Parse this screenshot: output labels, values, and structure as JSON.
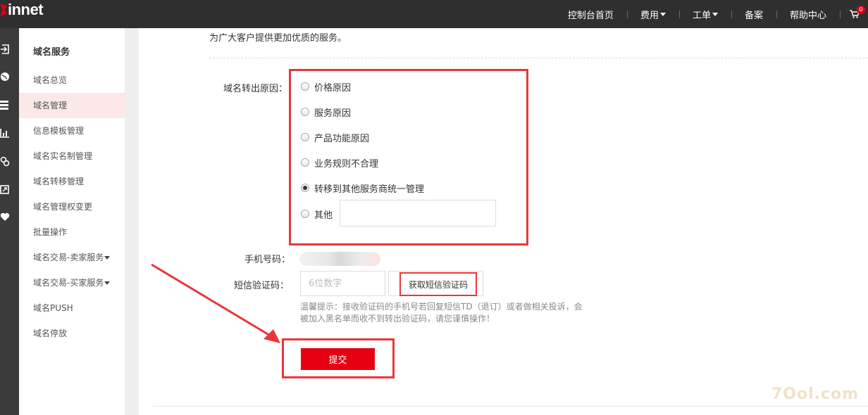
{
  "brand": {
    "logo_text": "innet"
  },
  "topnav": {
    "items": [
      {
        "label": "控制台首页",
        "has_caret": false
      },
      {
        "label": "费用",
        "has_caret": true
      },
      {
        "label": "工单",
        "has_caret": true
      },
      {
        "label": "备案",
        "has_caret": false
      },
      {
        "label": "帮助中心",
        "has_caret": false
      }
    ],
    "cart_count": "0"
  },
  "rail": {
    "icons": [
      "sign-in-icon",
      "globe-icon",
      "server-icon",
      "chart-icon",
      "link-icon",
      "resize-icon",
      "heart-icon"
    ]
  },
  "sidebar": {
    "title": "域名服务",
    "items": [
      {
        "label": "域名总览",
        "active": false
      },
      {
        "label": "域名管理",
        "active": true
      },
      {
        "label": "信息模板管理",
        "active": false
      },
      {
        "label": "域名实名制管理",
        "active": false
      },
      {
        "label": "域名转移管理",
        "active": false
      },
      {
        "label": "域名管理权变更",
        "active": false
      },
      {
        "label": "批量操作",
        "active": false
      },
      {
        "label": "域名交易-卖家服务",
        "active": false,
        "has_caret": true
      },
      {
        "label": "域名交易-买家服务",
        "active": false,
        "has_caret": true
      },
      {
        "label": "域名PUSH",
        "active": false
      },
      {
        "label": "域名停放",
        "active": false
      }
    ]
  },
  "form": {
    "intro_text": "为广大客户提供更加优质的服务。",
    "reason_label": "域名转出原因：",
    "reasons": [
      {
        "label": "价格原因",
        "checked": false
      },
      {
        "label": "服务原因",
        "checked": false
      },
      {
        "label": "产品功能原因",
        "checked": false
      },
      {
        "label": "业务规则不合理",
        "checked": false
      },
      {
        "label": "转移到其他服务商统一管理",
        "checked": true
      },
      {
        "label": "其他",
        "checked": false
      }
    ],
    "other_value": "",
    "phone_label": "手机号码：",
    "sms_label": "短信验证码：",
    "sms_placeholder": "6位数字",
    "sms_button": "获取短信验证码",
    "tip": "温馨提示：接收验证码的手机号若回复短信TD（退订）或者做相关投诉，会被加入黑名单而收不到转出验证码，请您谨慎操作！",
    "submit": "提交"
  },
  "watermark": "7Ool.com",
  "colors": {
    "brand_red": "#e60012",
    "highlight_red": "#e8373b",
    "topbar": "#2f2f2f",
    "rail": "#3b3b3b",
    "active_bg": "#fde8e9"
  }
}
